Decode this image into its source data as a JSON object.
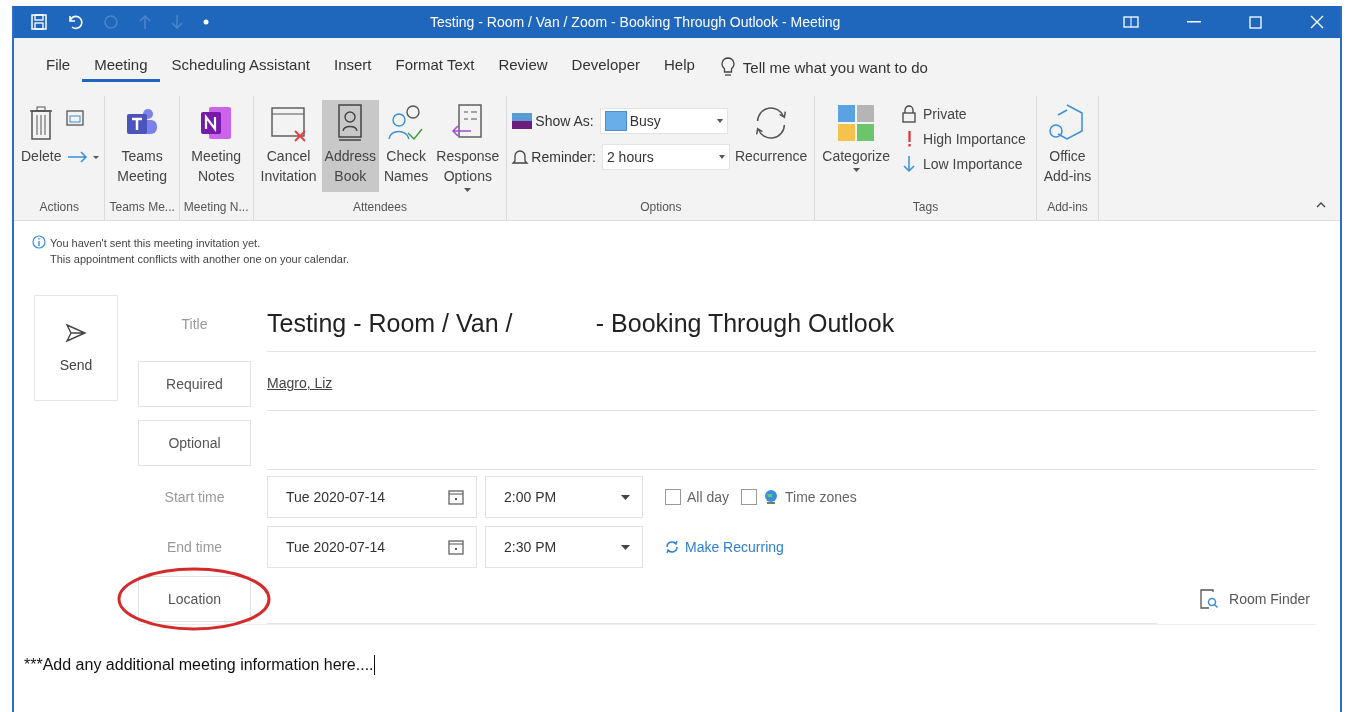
{
  "window": {
    "title": "Testing - Room / Van / Zoom - Booking Through Outlook  -  Meeting"
  },
  "tabs": [
    {
      "label": "File",
      "selected": false
    },
    {
      "label": "Meeting",
      "selected": true
    },
    {
      "label": "Scheduling Assistant",
      "selected": false
    },
    {
      "label": "Insert",
      "selected": false
    },
    {
      "label": "Format Text",
      "selected": false
    },
    {
      "label": "Review",
      "selected": false
    },
    {
      "label": "Developer",
      "selected": false
    },
    {
      "label": "Help",
      "selected": false
    }
  ],
  "tell_me": "Tell me what you want to do",
  "ribbon": {
    "groups": [
      {
        "label": "Actions",
        "items": [
          {
            "kind": "large",
            "lines": [
              "Delete"
            ],
            "pressed": false
          },
          {
            "kind": "stack"
          }
        ]
      },
      {
        "label": "Teams Me...",
        "items": [
          {
            "kind": "large",
            "lines": [
              "Teams",
              "Meeting"
            ],
            "pressed": false
          }
        ]
      },
      {
        "label": "Meeting N...",
        "items": [
          {
            "kind": "large",
            "lines": [
              "Meeting",
              "Notes"
            ],
            "pressed": false
          }
        ]
      },
      {
        "label": "Attendees",
        "items": [
          {
            "kind": "large",
            "lines": [
              "Cancel",
              "Invitation"
            ],
            "pressed": false
          },
          {
            "kind": "large",
            "lines": [
              "Address",
              "Book"
            ],
            "pressed": true
          },
          {
            "kind": "large",
            "lines": [
              "Check",
              "Names"
            ],
            "pressed": false
          },
          {
            "kind": "large",
            "lines": [
              "Response",
              "Options"
            ],
            "pressed": false,
            "dropdown": true
          }
        ]
      },
      {
        "label": "Options",
        "items": [
          {
            "kind": "fields",
            "fields": [
              {
                "label": "Show As:",
                "value": "Busy"
              },
              {
                "label": "Reminder:",
                "value": "2 hours"
              }
            ]
          },
          {
            "kind": "large",
            "lines": [
              "Recurrence"
            ],
            "pressed": false
          }
        ]
      },
      {
        "label": "Tags",
        "items": [
          {
            "kind": "large",
            "lines": [
              "Categorize"
            ],
            "pressed": false,
            "dropdown": true
          },
          {
            "kind": "smalls",
            "labels": [
              "Private",
              "High Importance",
              "Low Importance"
            ]
          }
        ]
      },
      {
        "label": "Add-ins",
        "items": [
          {
            "kind": "large",
            "lines": [
              "Office",
              "Add-ins"
            ],
            "pressed": false
          }
        ]
      }
    ]
  },
  "info": [
    "You haven't sent this meeting invitation yet.",
    "This appointment conflicts with another one on your calendar."
  ],
  "send": "Send",
  "title": {
    "label": "Title",
    "value": "Testing - Room / Van /            - Booking Through Outlook"
  },
  "required": {
    "label": "Required",
    "value": "Magro, Liz"
  },
  "optional": {
    "label": "Optional"
  },
  "times": [
    {
      "label": "Start time",
      "date": "Tue 2020-07-14",
      "time": "2:00 PM"
    },
    {
      "label": "End time",
      "date": "Tue 2020-07-14",
      "time": "2:30 PM"
    }
  ],
  "all_day": {
    "label": "All day",
    "checked": false
  },
  "time_zones": {
    "label": "Time zones",
    "checked": false
  },
  "make_recurring": "Make Recurring",
  "location": {
    "label": "Location"
  },
  "room_finder": "Room Finder",
  "body": "***Add any additional meeting information here...."
}
